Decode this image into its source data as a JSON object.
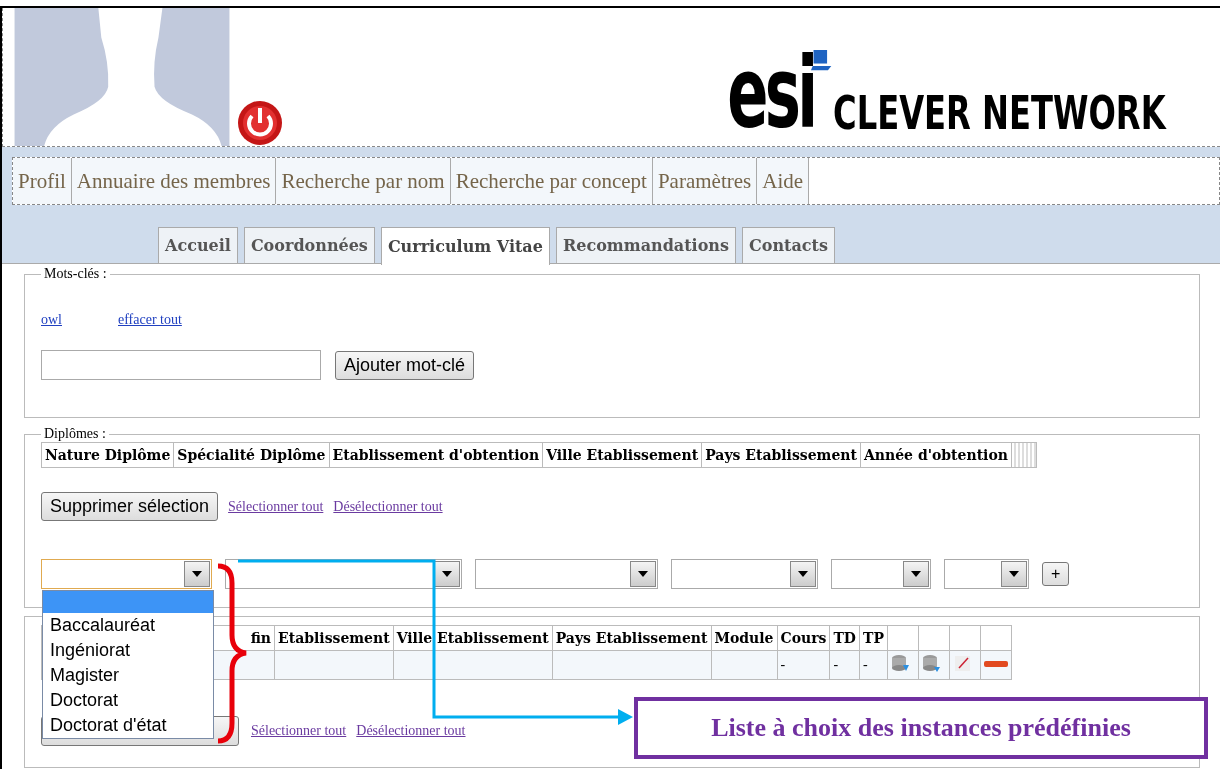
{
  "header": {
    "logo": {
      "mark": "esi",
      "name": "CLEVER NETWORK"
    }
  },
  "menu": [
    {
      "label": "Profil"
    },
    {
      "label": "Annuaire des membres"
    },
    {
      "label": "Recherche par nom"
    },
    {
      "label": "Recherche par concept"
    },
    {
      "label": "Paramètres"
    },
    {
      "label": "Aide"
    }
  ],
  "tabs": [
    {
      "label": "Accueil",
      "selected": false
    },
    {
      "label": "Coordonnées",
      "selected": false
    },
    {
      "label": "Curriculum Vitae",
      "selected": true
    },
    {
      "label": "Recommandations",
      "selected": false
    },
    {
      "label": "Contacts",
      "selected": false
    }
  ],
  "keywords": {
    "legend": "Mots-clés :",
    "links": [
      "owl",
      "effacer tout"
    ],
    "button": "Ajouter mot-clé"
  },
  "diplomas": {
    "legend": "Diplômes :",
    "columns": [
      "Nature Diplôme",
      "Spécialité Diplôme",
      "Etablissement d'obtention",
      "Ville Etablissement",
      "Pays Etablissement",
      "Année d'obtention"
    ],
    "button": "Supprimer sélection",
    "links": [
      "Sélectionner tout",
      "Désélectionner tout"
    ],
    "add_button": "+",
    "selects": [
      {
        "focused": true
      },
      {
        "focused": false
      },
      {
        "focused": false
      },
      {
        "focused": false
      },
      {
        "focused": false
      },
      {
        "focused": false
      }
    ]
  },
  "teaching": {
    "columns": [
      "fin",
      "Etablissement",
      "Ville Etablissement",
      "Pays Etablissement",
      "Module",
      "Cours",
      "TD",
      "TP"
    ],
    "row_values": [
      "-",
      "-",
      "-"
    ],
    "links": [
      "Sélectionner tout",
      "Désélectionner tout"
    ]
  },
  "dropdown": {
    "blank_highlighted": true,
    "options": [
      "Baccalauréat",
      "Ingéniorat",
      "Magister",
      "Doctorat",
      "Doctorat d'état"
    ]
  },
  "callout": {
    "text": "Liste à choix des instances prédéfinies"
  }
}
